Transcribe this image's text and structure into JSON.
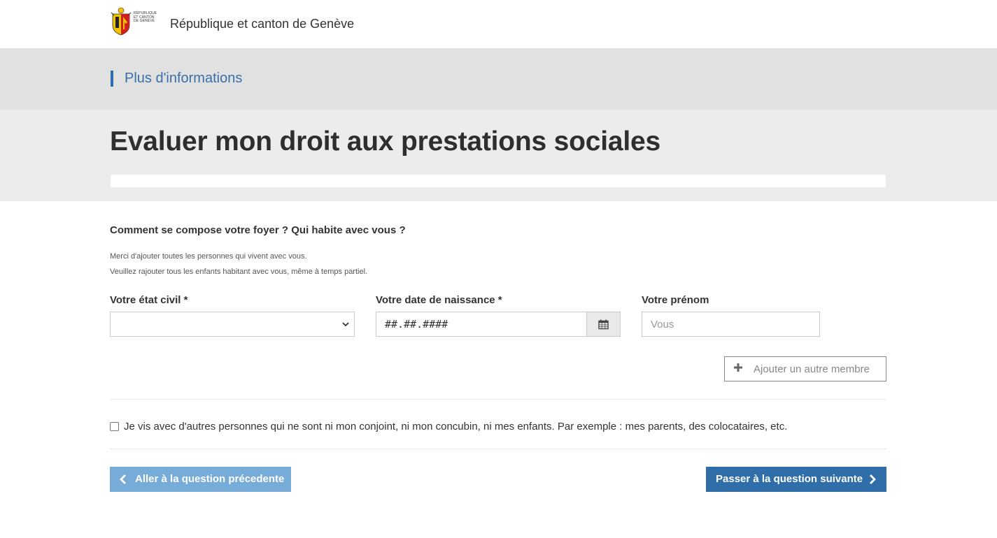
{
  "header": {
    "logo_text_lines": [
      "RÉPUBLIQUE",
      "ET CANTON",
      "DE GENÈVE"
    ],
    "site_title": "République et canton de Genève"
  },
  "info": {
    "link_label": "Plus d'informations"
  },
  "page": {
    "title": "Evaluer mon droit aux prestations sociales",
    "progress": 0
  },
  "form": {
    "question": "Comment se compose votre foyer ? Qui habite avec vous ?",
    "help_1": "Merci d'ajouter toutes les personnes qui vivent avec vous.",
    "help_2": "Veuillez rajouter tous les enfants habitant avec vous, même à temps partiel.",
    "civil_status_label": "Votre état civil *",
    "civil_status_value": "",
    "birthdate_label": "Votre date de naissance *",
    "birthdate_value": "##.##.####",
    "firstname_label": "Votre prénom",
    "firstname_placeholder": "Vous",
    "add_member_label": "Ajouter un autre membre",
    "other_persons_label": "Je vis avec d'autres personnes qui ne sont ni mon conjoint, ni mon concubin, ni mes enfants. Par exemple : mes parents, des colocataires, etc.",
    "other_persons_checked": false
  },
  "nav": {
    "prev_label": "Aller à la question précedente",
    "next_label": "Passer à la question suivante"
  },
  "icons": {
    "calendar": "calendar-icon",
    "plus": "plus-icon",
    "prev": "chevron-left-icon",
    "next": "chevron-right-icon",
    "select": "chevron-down-icon"
  },
  "colors": {
    "accent": "#2f6ea9",
    "accent_light": "#78acd8",
    "link": "#3a6fa8"
  }
}
